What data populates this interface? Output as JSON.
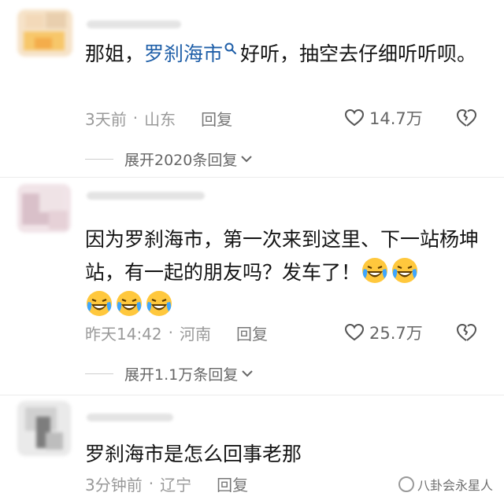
{
  "comments": [
    {
      "text_before": "那姐，",
      "highlight": "罗刹海市",
      "text_after": "好听，抽空去仔细听听呗。",
      "time": "3天前",
      "location": "山东",
      "reply_label": "回复",
      "likes": "14.7万",
      "expand_label": "展开2020条回复"
    },
    {
      "text": "因为罗刹海市，第一次来到这里、下一站杨坤站，有一起的朋友吗？发车了！",
      "time": "昨天14:42",
      "location": "河南",
      "reply_label": "回复",
      "likes": "25.7万",
      "expand_label": "展开1.1万条回复"
    },
    {
      "text": "罗刹海市是怎么回事老那",
      "time": "3分钟前",
      "location": "辽宁",
      "reply_label": "回复"
    }
  ],
  "separator": "·",
  "watermark": "八卦会永星人",
  "colors": {
    "link": "#1f5fa8",
    "meta": "#999999"
  }
}
